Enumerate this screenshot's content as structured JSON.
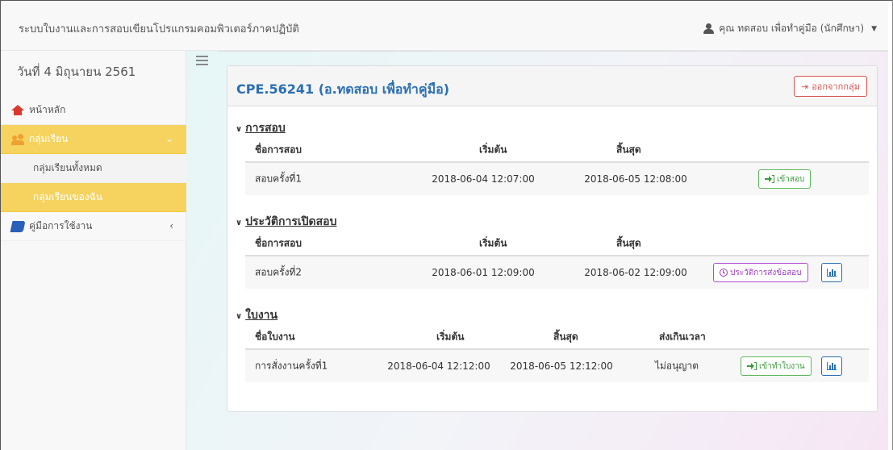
{
  "navbar": {
    "brand": "ระบบใบงานและการสอบเขียนโปรแกรมคอมพิวเตอร์ภาคปฏิบัติ",
    "user": "คุณ ทดสอบ เพื่อทำคู่มือ (นักศึกษา)"
  },
  "sidebar": {
    "date": "วันที่ 4 มิถุนายน 2561",
    "items": [
      {
        "label": "หน้าหลัก",
        "icon": "home-icon"
      },
      {
        "label": "กลุ่มเรียน",
        "icon": "group-icon"
      },
      {
        "label": "กลุ่มเรียนทั้งหมด"
      },
      {
        "label": "กลุ่มเรียนของฉัน"
      },
      {
        "label": "คู่มือการใช้งาน",
        "icon": "book-icon"
      }
    ]
  },
  "panel": {
    "title": "CPE.56241 (อ.ทดสอบ เพื่อทำคู่มือ)",
    "leave_label": "ออกจากกลุ่ม"
  },
  "exams": {
    "title": "การสอบ",
    "headers": [
      "ชื่อการสอบ",
      "เริ่มต้น",
      "สิ้นสุด"
    ],
    "rows": [
      {
        "name": "สอบครั้งที่1",
        "start": "2018-06-04 12:07:00",
        "end": "2018-06-05 12:08:00",
        "action": "เข้าสอบ"
      }
    ]
  },
  "history": {
    "title": "ประวัติการเปิดสอบ",
    "headers": [
      "ชื่อการสอบ",
      "เริ่มต้น",
      "สิ้นสุด"
    ],
    "rows": [
      {
        "name": "สอบครั้งที่2",
        "start": "2018-06-01 12:09:00",
        "end": "2018-06-02 12:09:00",
        "action": "ประวัติการส่งข้อสอบ"
      }
    ]
  },
  "worksheets": {
    "title": "ใบงาน",
    "headers": [
      "ชื่อใบงาน",
      "เริ่มต้น",
      "สิ้นสุด",
      "ส่งเกินเวลา"
    ],
    "rows": [
      {
        "name": "การสั่งงานครั้งที่1",
        "start": "2018-06-04 12:12:00",
        "end": "2018-06-05 12:12:00",
        "late": "ไม่อนุญาต",
        "action": "เข้าทำใบงาน"
      }
    ]
  },
  "colors": {
    "accent_yellow": "#f5d35e",
    "title_blue": "#2a6fb4",
    "danger": "#d9534f",
    "success": "#5cb85c",
    "purple": "#b04bd6"
  }
}
